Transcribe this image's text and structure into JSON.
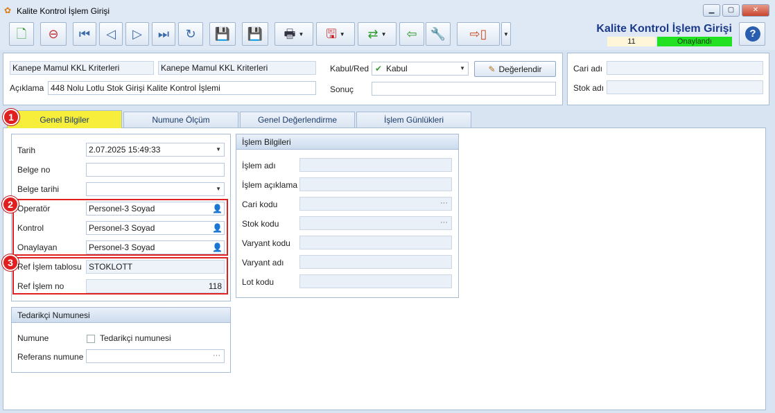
{
  "window": {
    "title": "Kalite Kontrol İşlem Girişi"
  },
  "header": {
    "title": "Kalite Kontrol İşlem Girişi",
    "record_no": "11",
    "status": "Onaylandı"
  },
  "toolbar": {
    "buttons": [
      "new-record",
      "delete-record",
      "first-record",
      "previous-record",
      "next-record",
      "last-record",
      "refresh",
      "save",
      "save-close",
      "print",
      "pdf-export",
      "import-export",
      "undo-back",
      "settings",
      "exit"
    ]
  },
  "top": {
    "criteria_left": "Kanepe Mamul KKL Kriterleri",
    "criteria_right": "Kanepe Mamul KKL Kriterleri",
    "aciklama_label": "Açıklama",
    "aciklama_value": "448 Nolu Lotlu Stok Girişi Kalite Kontrol İşlemi",
    "kabul_label": "Kabul/Red",
    "kabul_value": "Kabul",
    "degerlendir_label": "Değerlendir",
    "sonuc_label": "Sonuç",
    "sonuc_value": "",
    "cari_label": "Cari adı",
    "stok_label": "Stok adı"
  },
  "tabs": [
    {
      "label": "Genel Bilgiler",
      "active": true
    },
    {
      "label": "Numune Ölçüm"
    },
    {
      "label": "Genel Değerlendirme"
    },
    {
      "label": "İşlem Günlükleri"
    }
  ],
  "markers": [
    "1",
    "2",
    "3"
  ],
  "general": {
    "tarih_label": "Tarih",
    "tarih_value": "2.07.2025 15:49:33",
    "belge_no_label": "Belge no",
    "belge_no_value": "",
    "belge_tarihi_label": "Belge tarihi",
    "belge_tarihi_value": "",
    "operator_label": "Operatör",
    "operator_value": "Personel-3 Soyad",
    "kontrol_label": "Kontrol",
    "kontrol_value": "Personel-3 Soyad",
    "onaylayan_label": "Onaylayan",
    "onaylayan_value": "Personel-3 Soyad",
    "ref_tablo_label": "Ref İşlem tablosu",
    "ref_tablo_value": "STOKLOTT",
    "ref_no_label": "Ref İşlem no",
    "ref_no_value": "118"
  },
  "islem": {
    "title": "İşlem Bilgileri",
    "fields": [
      "İşlem adı",
      "İşlem açıklama",
      "Cari kodu",
      "Stok kodu",
      "Varyant kodu",
      "Varyant adı",
      "Lot kodu"
    ]
  },
  "tedarikci": {
    "title": "Tedarikçi Numunesi",
    "numune_label": "Numune",
    "checkbox_label": "Tedarikçi numunesi",
    "ref_numune_label": "Referans numune"
  },
  "colors": {
    "active_tab": "#f6ee3a",
    "status": "#22e022",
    "marker": "#e02020",
    "title": "#1b3a8a"
  }
}
